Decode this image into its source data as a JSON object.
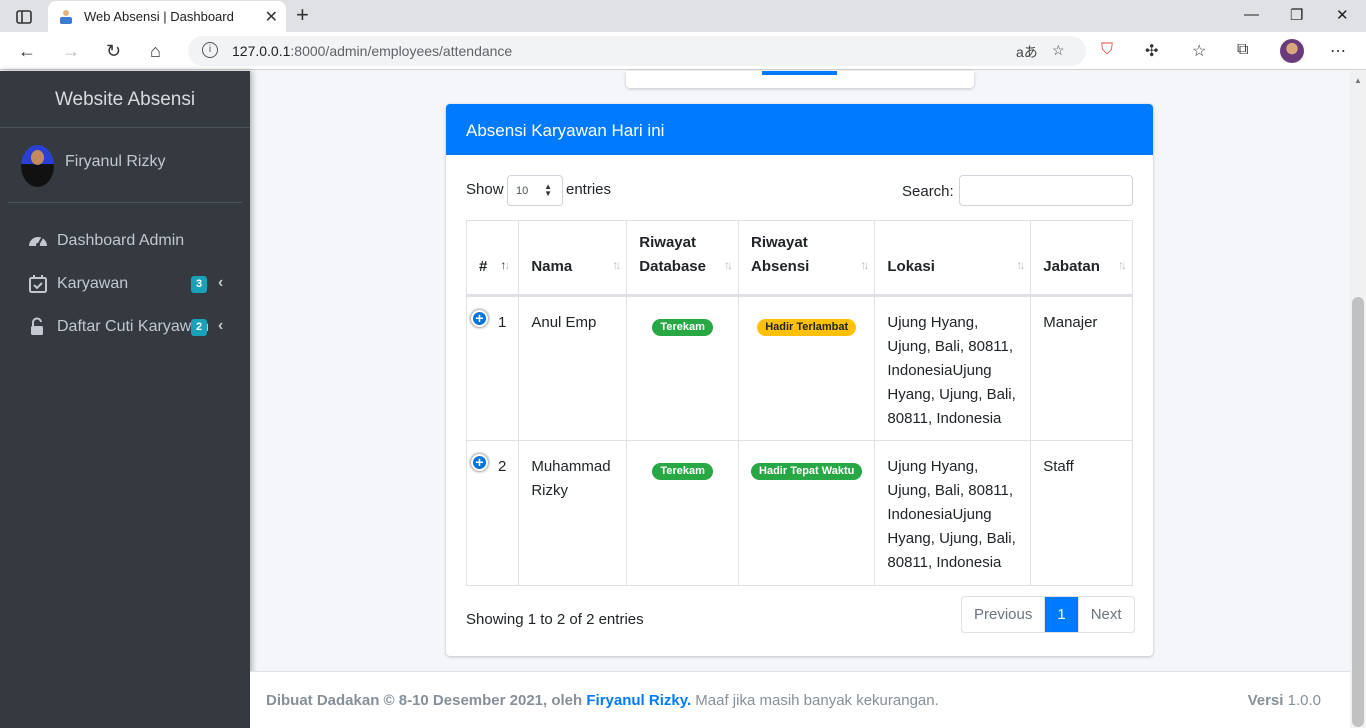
{
  "browser": {
    "tab_title": "Web Absensi | Dashboard",
    "url_host": "127.0.0.1",
    "url_path": ":8000/admin/employees/attendance"
  },
  "sidebar": {
    "brand": "Website Absensi",
    "user_name": "Firyanul Rizky",
    "items": [
      {
        "label": "Dashboard Admin",
        "icon": "tachometer-icon"
      },
      {
        "label": "Karyawan",
        "icon": "calendar-check-icon",
        "badge": "3"
      },
      {
        "label": "Daftar Cuti Karyawan",
        "icon": "unlock-icon",
        "badge": "2"
      }
    ]
  },
  "card": {
    "title": "Absensi Karyawan Hari ini",
    "show_label": "Show",
    "entries_value": "10",
    "entries_label": "entries",
    "search_label": "Search:",
    "columns": [
      "#",
      "Nama",
      "Riwayat Database",
      "Riwayat Absensi",
      "Lokasi",
      "Jabatan"
    ],
    "rows": [
      {
        "no": "1",
        "nama": "Anul Emp",
        "database": "Terekam",
        "absensi": "Hadir Terlambat",
        "lokasi": "Ujung Hyang, Ujung, Bali, 80811, IndonesiaUjung Hyang, Ujung, Bali, 80811, Indonesia",
        "jabatan": "Manajer"
      },
      {
        "no": "2",
        "nama": "Muhammad Rizky",
        "database": "Terekam",
        "absensi": "Hadir Tepat Waktu",
        "lokasi": "Ujung Hyang, Ujung, Bali, 80811, IndonesiaUjung Hyang, Ujung, Bali, 80811, Indonesia",
        "jabatan": "Staff"
      }
    ],
    "info": "Showing 1 to 2 of 2 entries",
    "pager": {
      "previous": "Previous",
      "page": "1",
      "next": "Next"
    }
  },
  "footer": {
    "left_bold": "Dibuat Dadakan © 8-10 Desember 2021, oleh",
    "author": "Firyanul Rizky.",
    "note": "Maaf jika masih banyak kekurangan.",
    "version_label": "Versi",
    "version": "1.0.0"
  },
  "colors": {
    "primary": "#007bff",
    "success": "#28a745",
    "warning": "#ffc107",
    "info": "#17a2b8",
    "sidebar": "#343a40"
  }
}
